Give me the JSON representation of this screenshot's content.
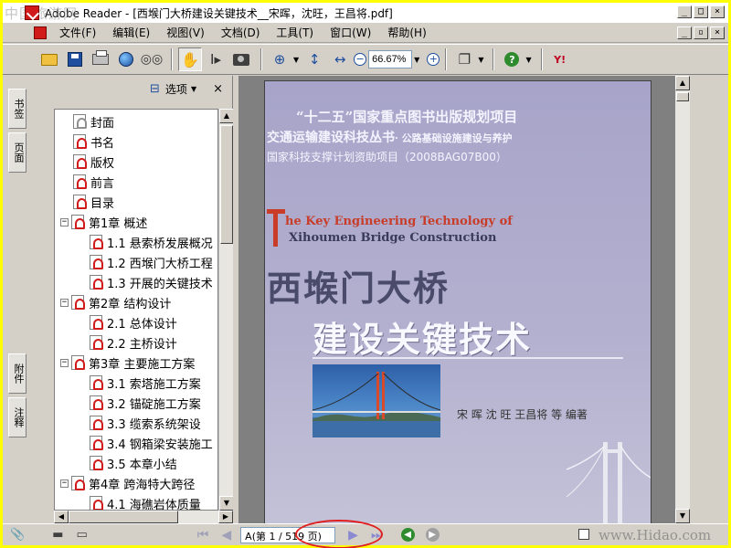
{
  "window": {
    "title": "Adobe Reader - [西堠门大桥建设关键技术__宋晖，沈旺，王昌将.pdf]",
    "watermark": "中国旅游网"
  },
  "menu": [
    "文件(F)",
    "编辑(E)",
    "视图(V)",
    "文档(D)",
    "工具(T)",
    "窗口(W)",
    "帮助(H)"
  ],
  "toolbar": {
    "zoom": "66.67%"
  },
  "tabs": {
    "bookmarks": "书签",
    "pages": "页面",
    "attachments": "附件",
    "comments": "注释"
  },
  "bookmarks_panel": {
    "options_label": "选项",
    "items": [
      {
        "label": "封面",
        "level": 0
      },
      {
        "label": "书名",
        "level": 0
      },
      {
        "label": "版权",
        "level": 0
      },
      {
        "label": "前言",
        "level": 0
      },
      {
        "label": "目录",
        "level": 0
      },
      {
        "label": "第1章  概述",
        "level": 0
      },
      {
        "label": "1.1  悬索桥发展概况",
        "level": 1
      },
      {
        "label": "1.2  西堠门大桥工程",
        "level": 1
      },
      {
        "label": "1.3  开展的关键技术",
        "level": 1
      },
      {
        "label": "第2章  结构设计",
        "level": 0
      },
      {
        "label": "2.1  总体设计",
        "level": 1
      },
      {
        "label": "2.2  主桥设计",
        "level": 1
      },
      {
        "label": "第3章  主要施工方案",
        "level": 0
      },
      {
        "label": "3.1  索塔施工方案",
        "level": 1
      },
      {
        "label": "3.2  锚碇施工方案",
        "level": 1
      },
      {
        "label": "3.3  缆索系统架设",
        "level": 1
      },
      {
        "label": "3.4  钢箱梁安装施工",
        "level": 1
      },
      {
        "label": "3.5  本章小结",
        "level": 1
      },
      {
        "label": "第4章  跨海特大跨径",
        "level": 0
      },
      {
        "label": "4.1  海礁岩体质量",
        "level": 1
      }
    ]
  },
  "cover": {
    "series_line1": "“十二五”国家重点图书出版规划项目",
    "series_line2": "交通运输建设科技丛书",
    "series_line2_sub": "· 公路基础设施建设与养护",
    "project": "国家科技支撑计划资助项目（2008BAG07B00）",
    "english_line1": "he Key Engineering Technology of",
    "english_line2": "Xihoumen Bridge Construction",
    "title_line1": "西堠门大桥",
    "title_line2": "建设关键技术",
    "authors": "宋  晖  沈  旺  王昌将  等  编著"
  },
  "statusbar": {
    "page_display": "A(第 1 / 519 页)",
    "watermark": "www.Hidao.com"
  }
}
